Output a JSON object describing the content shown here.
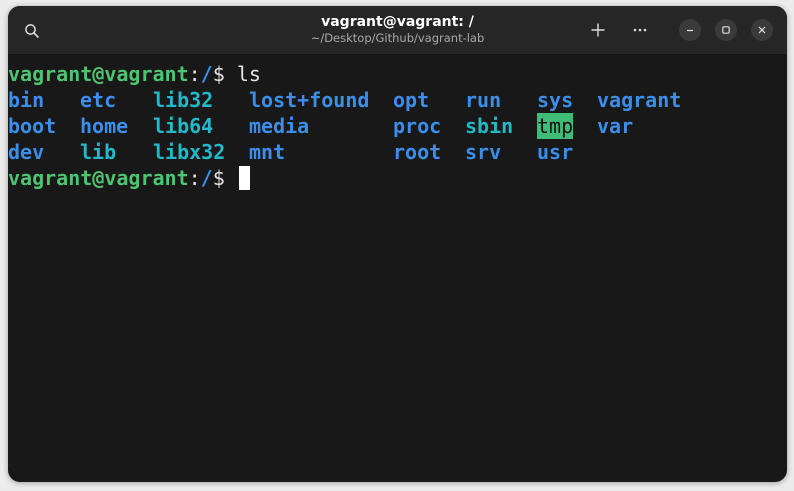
{
  "window": {
    "title": "vagrant@vagrant: /",
    "subtitle": "~/Desktop/Github/vagrant-lab"
  },
  "colors": {
    "background": "#181818",
    "titlebar": "#262626",
    "prompt_user": "#4ec471",
    "prompt_path": "#3b8eea",
    "directory": "#3b8eea",
    "symlink": "#22b9c9",
    "sticky_bg": "#3fbd78"
  },
  "titlebar_icons": {
    "search": "search-icon",
    "new_tab": "plus-icon",
    "menu": "ellipsis-icon",
    "minimize": "minimize-icon",
    "maximize": "maximize-icon",
    "close": "close-icon"
  },
  "terminal": {
    "prompt1": {
      "user": "vagrant@vagrant",
      "colon": ":",
      "path": "/",
      "dollar": "$ ",
      "command": "ls"
    },
    "listing": [
      [
        "bin",
        "etc",
        "lib32",
        "lost+found",
        "opt",
        "run",
        "sys",
        "vagrant"
      ],
      [
        "boot",
        "home",
        "lib64",
        "media",
        "proc",
        "sbin",
        "tmp",
        "var"
      ],
      [
        "dev",
        "lib",
        "libx32",
        "mnt",
        "",
        "root",
        "srv",
        "usr"
      ]
    ],
    "listing_col4_row3": "root",
    "prompt2": {
      "user": "vagrant@vagrant",
      "colon": ":",
      "path": "/",
      "dollar": "$ "
    }
  }
}
